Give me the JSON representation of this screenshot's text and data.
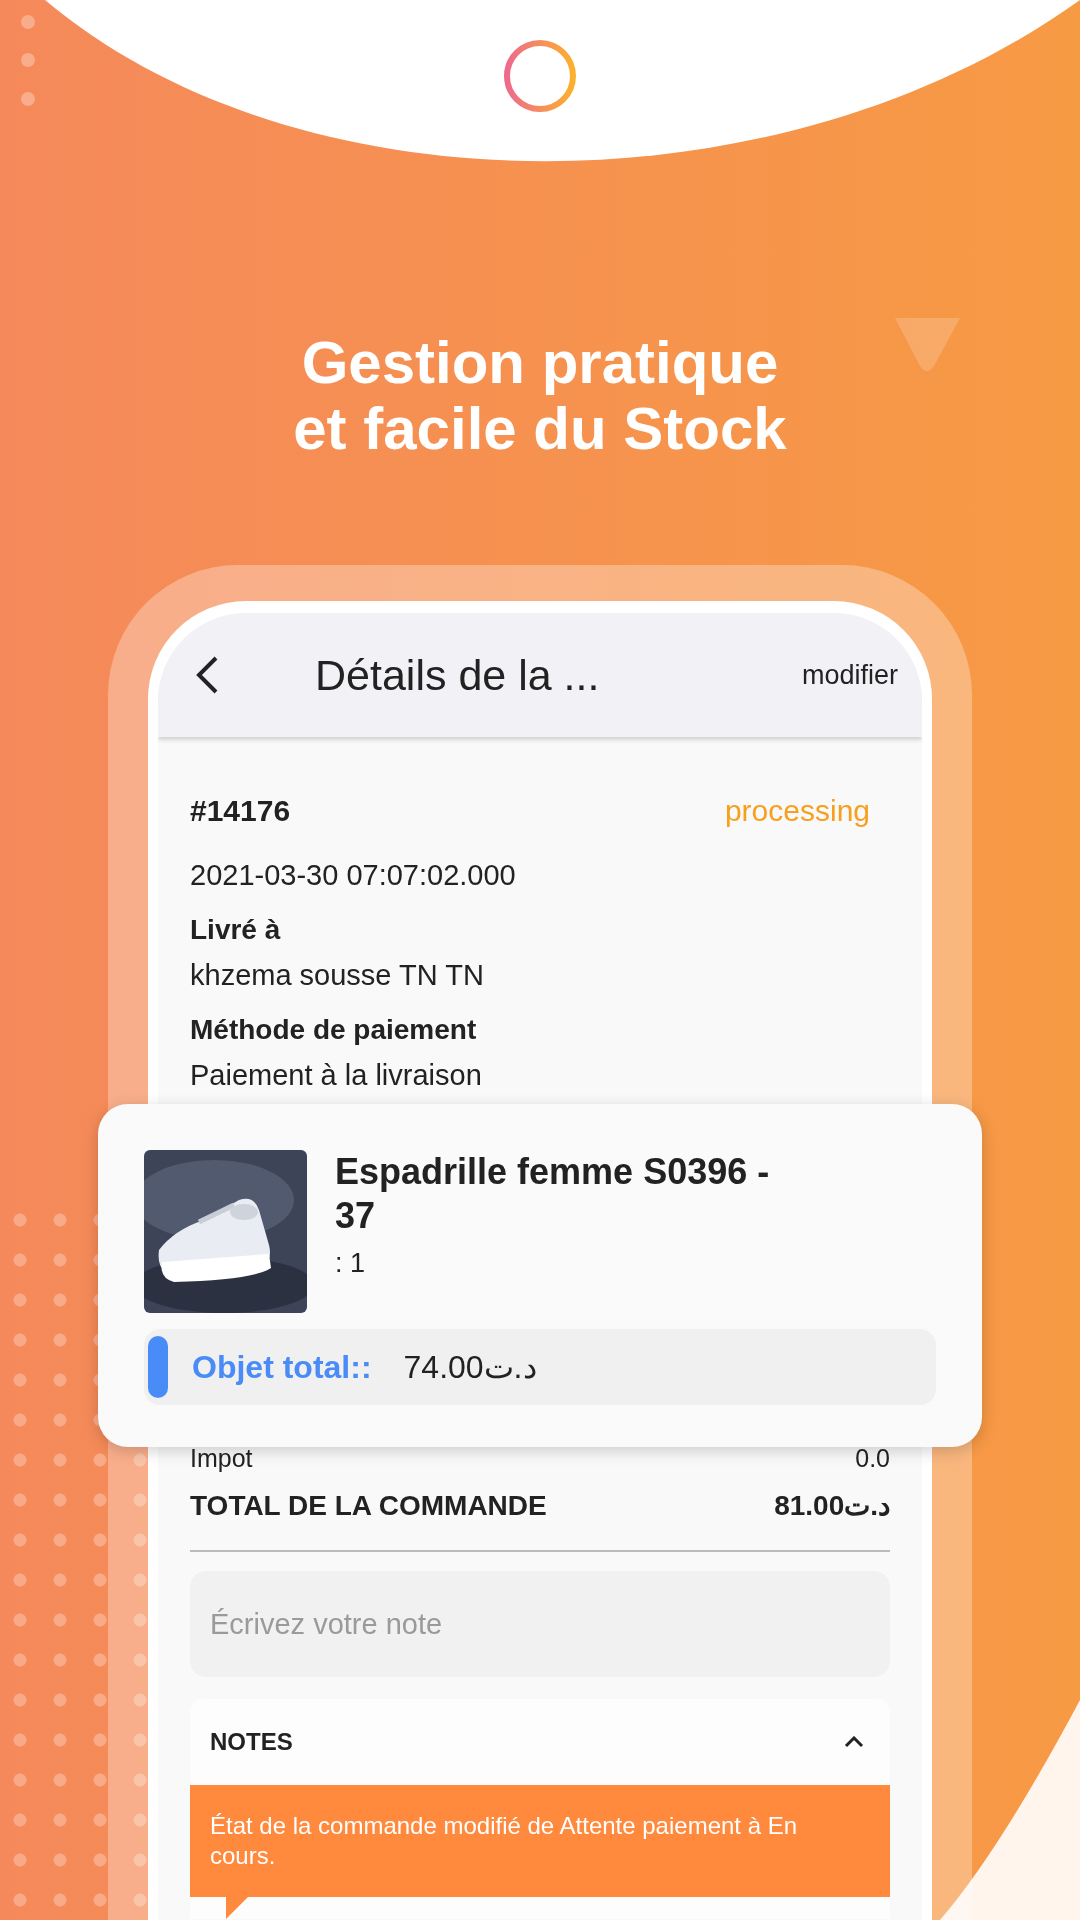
{
  "headline": [
    "Gestion pratique",
    "et facile du Stock"
  ],
  "app_bar": {
    "title": "Détails de la ...",
    "action": "modifier"
  },
  "order": {
    "number": "#14176",
    "status": "processing",
    "date": "2021-03-30 07:07:02.000",
    "fields": [
      {
        "label": "Livré à",
        "value": "khzema sousse TN  TN"
      },
      {
        "label": "Méthode de paiement",
        "value": "Paiement à la livraison"
      }
    ]
  },
  "item_card": {
    "name": "Espadrille femme S0396 - 37",
    "quantity": ": 1",
    "total_label": "Objet total::",
    "total_value": "74.00د.ت"
  },
  "summary": [
    {
      "label": "Impot",
      "value": "0.0",
      "kind": "plain"
    },
    {
      "label": "TOTAL DE LA COMMANDE",
      "value": "81.00د.ت",
      "kind": "total"
    }
  ],
  "note_field": {
    "placeholder": "Écrivez votre note"
  },
  "notes": {
    "title": "NOTES",
    "expanded": true,
    "items": [
      "État de la commande modifié de Attente paiement à En cours."
    ]
  }
}
